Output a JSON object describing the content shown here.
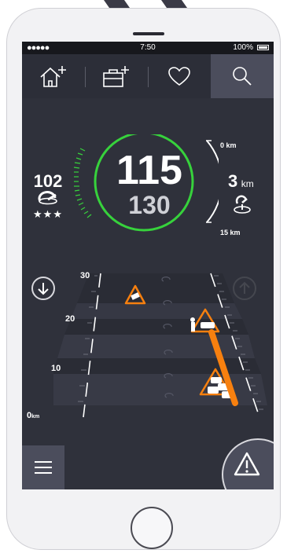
{
  "status_bar": {
    "signal": "●●●●●",
    "time": "7:50",
    "battery": "100%"
  },
  "nav": {
    "items": [
      {
        "icon": "home-add-icon"
      },
      {
        "icon": "work-add-icon"
      },
      {
        "icon": "heart-icon"
      },
      {
        "icon": "search-icon",
        "selected": true
      }
    ]
  },
  "dashboard": {
    "avg_speed": "102",
    "rating_stars": "★★★",
    "current_speed": "115",
    "speed_limit": "130",
    "distance_value": "3",
    "distance_unit": "km",
    "range_top_label": "0 km",
    "range_bottom_label": "15 km"
  },
  "road_view": {
    "scale_labels": [
      "30",
      "20",
      "10",
      "0"
    ],
    "zero_unit": "km",
    "progress_fraction": 0.35
  },
  "colors": {
    "accent_green": "#37d23c",
    "accent_orange": "#f7800f",
    "screen_bg": "#2f313b"
  }
}
